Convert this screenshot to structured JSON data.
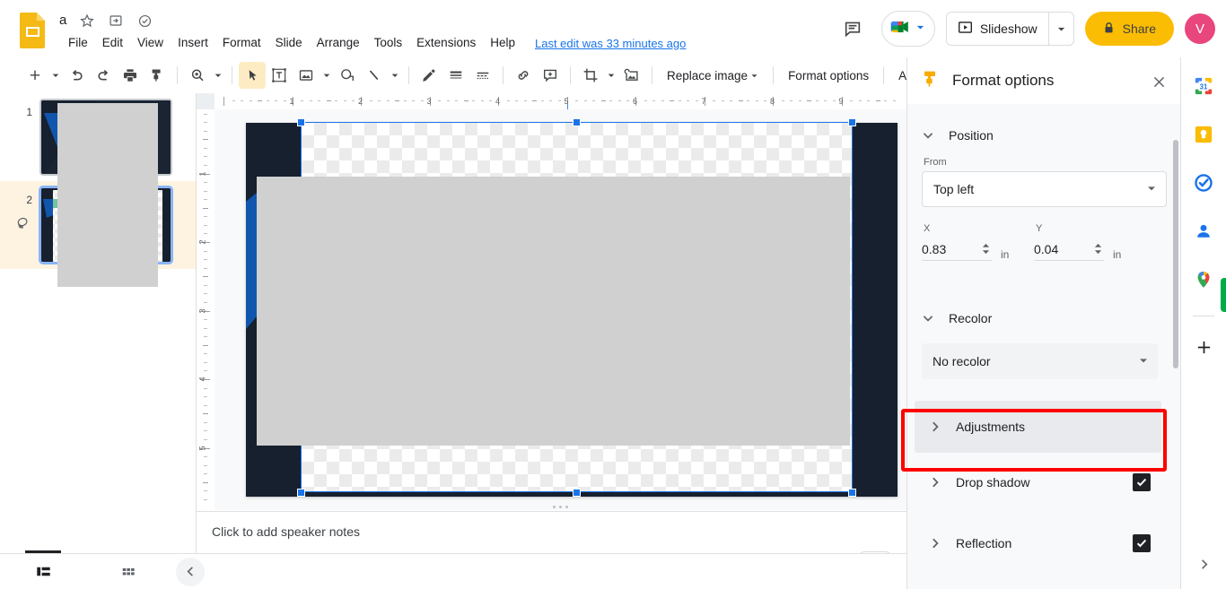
{
  "app": {
    "name": "Google Slides",
    "logo_icon": "slides-logo-icon"
  },
  "header": {
    "doc_title": "a",
    "star_icon": "star-icon",
    "move_icon": "move-to-folder-icon",
    "cloud_icon": "saved-to-drive-icon",
    "last_edit": "Last edit was 33 minutes ago",
    "menus": [
      "File",
      "Edit",
      "View",
      "Insert",
      "Format",
      "Slide",
      "Arrange",
      "Tools",
      "Extensions",
      "Help"
    ],
    "comment_icon": "comment-history-icon",
    "meet_icon": "google-meet-icon",
    "meet_caret": "chevron-down-icon",
    "slideshow_label": "Slideshow",
    "slideshow_icon": "present-icon",
    "slideshow_caret": "chevron-down-icon",
    "share_label": "Share",
    "share_lock_icon": "lock-icon",
    "avatar_initial": "V"
  },
  "toolbar": {
    "items": [
      {
        "name": "new-slide-button",
        "icon": "plus-icon",
        "caret": true
      },
      {
        "name": "undo-button",
        "icon": "undo-icon"
      },
      {
        "name": "redo-button",
        "icon": "redo-icon"
      },
      {
        "name": "print-button",
        "icon": "print-icon"
      },
      {
        "name": "paint-format-button",
        "icon": "paint-format-icon"
      },
      {
        "name": "zoom-button",
        "icon": "zoom-icon",
        "caret": true
      },
      {
        "name": "select-tool-button",
        "icon": "cursor-arrow-icon",
        "active": true
      },
      {
        "name": "text-box-button",
        "icon": "text-box-icon"
      },
      {
        "name": "insert-image-button",
        "icon": "image-icon",
        "caret": true
      },
      {
        "name": "shape-button",
        "icon": "shape-icon"
      },
      {
        "name": "line-button",
        "icon": "line-icon",
        "caret": true
      },
      {
        "name": "pen-button",
        "icon": "pen-icon"
      },
      {
        "name": "line-weight-button",
        "icon": "line-weight-icon"
      },
      {
        "name": "line-dash-button",
        "icon": "line-dash-icon"
      },
      {
        "name": "insert-link-button",
        "icon": "link-icon"
      },
      {
        "name": "add-comment-button",
        "icon": "add-comment-icon"
      },
      {
        "name": "crop-button",
        "icon": "crop-icon",
        "caret": true
      },
      {
        "name": "mask-image-button",
        "icon": "mask-image-icon"
      }
    ],
    "replace_image_label": "Replace image",
    "format_options_label": "Format options",
    "animate_label": "Animate",
    "collapse_icon": "chevron-up-icon"
  },
  "filmstrip": {
    "slides": [
      {
        "number": "1",
        "selected": false,
        "skipped": false
      },
      {
        "number": "2",
        "selected": true,
        "skipped": true,
        "skip_icon": "skip-slide-icon"
      }
    ]
  },
  "canvas": {
    "h_ruler_labels": [
      "1",
      "2",
      "3",
      "4",
      "5",
      "6",
      "7",
      "8",
      "9"
    ],
    "v_ruler_labels": [
      "1",
      "2",
      "3",
      "4",
      "5"
    ],
    "slide_background_color": "#17202e",
    "accent_blue": "#1156ad",
    "accent_green": "#74c4a0",
    "selected_object": "image",
    "selection_color": "#1a73e8"
  },
  "notes": {
    "placeholder": "Click to add speaker notes"
  },
  "bottombar": {
    "filmstrip_view_icon": "filmstrip-view-icon",
    "grid_view_icon": "grid-view-icon",
    "collapse_icon": "chevron-left-icon",
    "gemini_icon": "gemini-spark-icon"
  },
  "panel": {
    "title": "Format options",
    "header_icon": "format-paint-icon",
    "close_icon": "close-icon",
    "position": {
      "section_label": "Position",
      "expanded": true,
      "chevron": "chevron-down-icon",
      "from_label": "From",
      "from_value": "Top left",
      "x_label": "X",
      "x_value": "0.83",
      "x_unit": "in",
      "y_label": "Y",
      "y_value": "0.04",
      "y_unit": "in"
    },
    "recolor": {
      "section_label": "Recolor",
      "expanded": true,
      "chevron": "chevron-down-icon",
      "value": "No recolor"
    },
    "sections": [
      {
        "label": "Adjustments",
        "chevron": "chevron-right-icon",
        "checkbox": false,
        "highlighted": true
      },
      {
        "label": "Drop shadow",
        "chevron": "chevron-right-icon",
        "checkbox": true,
        "checked": true,
        "highlighted": false
      },
      {
        "label": "Reflection",
        "chevron": "chevron-right-icon",
        "checkbox": true,
        "checked": true,
        "highlighted": false
      }
    ],
    "highlight_color": "#ff0000"
  },
  "rail": {
    "icons": [
      {
        "name": "google-calendar-icon",
        "label": "Calendar"
      },
      {
        "name": "google-keep-icon",
        "label": "Keep"
      },
      {
        "name": "google-tasks-icon",
        "label": "Tasks"
      },
      {
        "name": "google-contacts-icon",
        "label": "Contacts"
      },
      {
        "name": "google-maps-icon",
        "label": "Maps"
      }
    ],
    "add_icon": "plus-icon",
    "expand_icon": "chevron-right-icon"
  }
}
